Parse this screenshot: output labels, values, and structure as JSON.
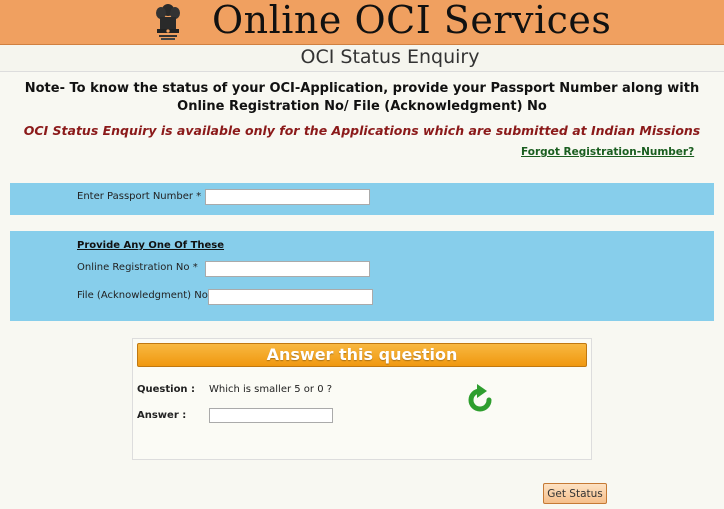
{
  "header": {
    "site_title": "Online OCI Services"
  },
  "subheader": {
    "title": "OCI Status Enquiry"
  },
  "note": "Note- To know the status of your OCI-Application, provide your Passport Number along with Online Registration No/ File (Acknowledgment) No",
  "missions_note": "OCI Status Enquiry is available only for the Applications which are submitted at Indian Missions",
  "forgot_link": "Forgot Registration-Number?",
  "passport": {
    "label": "Enter Passport Number *",
    "value": ""
  },
  "any_one": {
    "title": "Provide Any One Of These",
    "registration": {
      "label": "Online Registration No *",
      "value": ""
    },
    "file_ack": {
      "label": "File (Acknowledgment) No *",
      "value": ""
    }
  },
  "captcha": {
    "title": "Answer this question",
    "question_label": "Question :",
    "question_text": "Which is smaller 5 or 0 ?",
    "answer_label": "Answer :",
    "answer_value": ""
  },
  "submit_label": "Get Status",
  "colors": {
    "header": "#f0a060",
    "panel": "#87ceeb",
    "missions_text": "#8b1a1a",
    "link": "#1a5e20",
    "captcha_bar": "#f5a623"
  }
}
